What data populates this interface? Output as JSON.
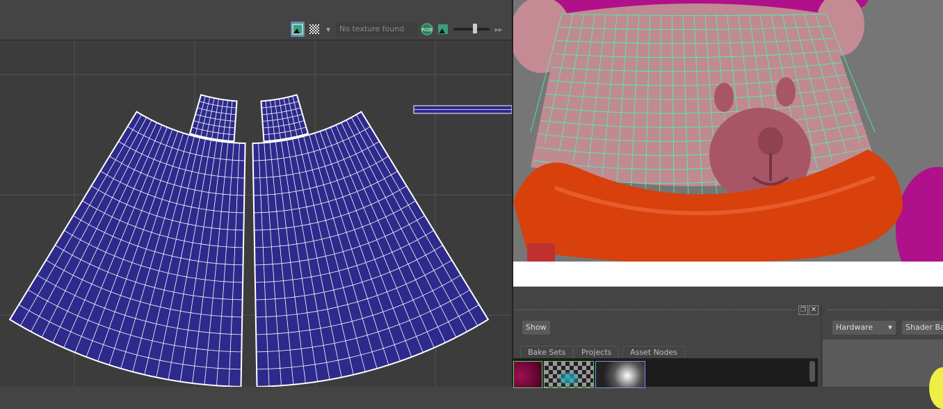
{
  "uv_toolbar": {
    "texture_field": "No texture found",
    "rgb_label": "RGB"
  },
  "bottom_panel": {
    "show_button": "Show",
    "tabs": [
      "Bake Sets",
      "Projects",
      "Asset Nodes"
    ],
    "renderer_select": "Hardware",
    "shader_ball_select": "Shader Ball"
  },
  "colors": {
    "uv_shell": "#2d2a8c",
    "wire": "#3dffb0",
    "skin": "#c48b95",
    "scarf": "#d8400c",
    "hat": "#b0108a"
  }
}
